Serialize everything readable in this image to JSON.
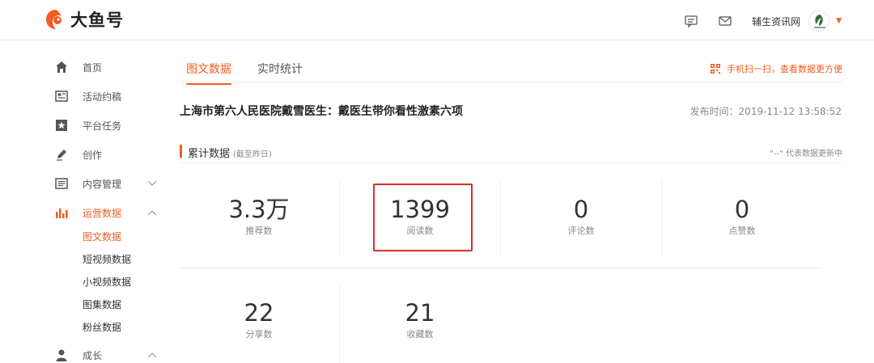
{
  "brand": {
    "name": "大鱼号"
  },
  "header": {
    "message_icon": "message-icon",
    "mail_icon": "mail-icon",
    "username": "辅生资讯网"
  },
  "sidebar": {
    "items": [
      {
        "label": "首页",
        "icon": "home-icon"
      },
      {
        "label": "活动约稿",
        "icon": "newspaper-icon"
      },
      {
        "label": "平台任务",
        "icon": "star-bookmark-icon"
      },
      {
        "label": "创作",
        "icon": "pen-icon"
      },
      {
        "label": "内容管理",
        "icon": "document-list-icon"
      },
      {
        "label": "运营数据",
        "icon": "bar-chart-icon"
      }
    ],
    "sub_items": [
      "图文数据",
      "短视频数据",
      "小视频数据",
      "图集数据",
      "粉丝数据"
    ],
    "growth_label": "成长"
  },
  "tabs": [
    {
      "label": "图文数据",
      "active": true
    },
    {
      "label": "实时统计",
      "active": false
    }
  ],
  "scan_text": "手机扫一扫，查看数据更方便",
  "article": {
    "title": "上海市第六人民医院戴雪医生：戴医生带你看性激素六项",
    "publish_time": "发布时间：2019-11-12 13:58:52"
  },
  "section": {
    "title": "累计数据",
    "note": "(截至昨日)",
    "hint": "\"--\" 代表数据更新中"
  },
  "stats": [
    {
      "value": "3.3万",
      "label": "推荐数"
    },
    {
      "value": "1399",
      "label": "阅读数"
    },
    {
      "value": "0",
      "label": "评论数"
    },
    {
      "value": "0",
      "label": "点赞数"
    },
    {
      "value": "22",
      "label": "分享数"
    },
    {
      "value": "21",
      "label": "收藏数"
    }
  ],
  "colors": {
    "accent": "#f05d23",
    "highlight_box": "#d93025"
  }
}
